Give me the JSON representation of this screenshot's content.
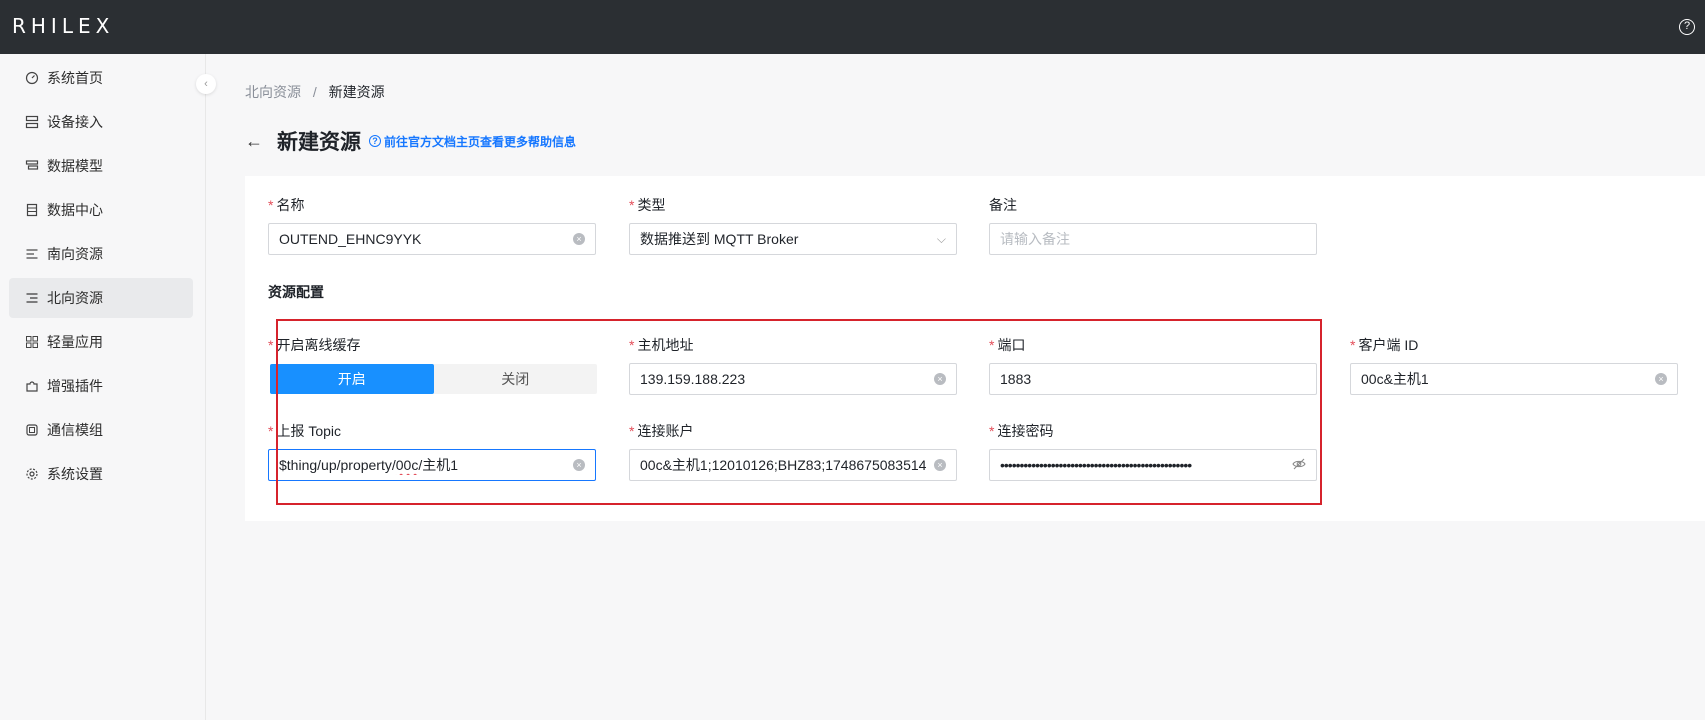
{
  "app": {
    "logo": "RHILEX",
    "help_icon": "help-circle-icon"
  },
  "sidebar": {
    "items": [
      {
        "label": "系统首页",
        "icon": "dashboard-icon",
        "active": false
      },
      {
        "label": "设备接入",
        "icon": "device-icon",
        "active": false
      },
      {
        "label": "数据模型",
        "icon": "model-icon",
        "active": false
      },
      {
        "label": "数据中心",
        "icon": "database-icon",
        "active": false
      },
      {
        "label": "南向资源",
        "icon": "south-resource-icon",
        "active": false
      },
      {
        "label": "北向资源",
        "icon": "north-resource-icon",
        "active": true
      },
      {
        "label": "轻量应用",
        "icon": "apps-icon",
        "active": false
      },
      {
        "label": "增强插件",
        "icon": "plugin-icon",
        "active": false
      },
      {
        "label": "通信模组",
        "icon": "module-icon",
        "active": false
      },
      {
        "label": "系统设置",
        "icon": "settings-icon",
        "active": false
      }
    ]
  },
  "breadcrumb": {
    "parent": "北向资源",
    "separator": "/",
    "current": "新建资源"
  },
  "header": {
    "title": "新建资源",
    "doc_link": "前往官方文档主页查看更多帮助信息"
  },
  "form": {
    "name": {
      "label": "名称",
      "required": true,
      "value": "OUTEND_EHNC9YYK"
    },
    "type": {
      "label": "类型",
      "required": true,
      "value": "数据推送到 MQTT Broker"
    },
    "remark": {
      "label": "备注",
      "required": false,
      "value": "",
      "placeholder": "请输入备注"
    },
    "section_title": "资源配置",
    "cache": {
      "label": "开启离线缓存",
      "required": true,
      "on_label": "开启",
      "off_label": "关闭",
      "selected": "开启"
    },
    "host": {
      "label": "主机地址",
      "required": true,
      "value": "139.159.188.223"
    },
    "port": {
      "label": "端口",
      "required": true,
      "value": "1883"
    },
    "client_id": {
      "label": "客户端 ID",
      "required": true,
      "value": "00c&主机1"
    },
    "topic": {
      "label": "上报 Topic",
      "required": true,
      "value_prefix": "$thing/up/property/",
      "value_misspelled": "00c",
      "value_suffix": "/主机1"
    },
    "username": {
      "label": "连接账户",
      "required": true,
      "value": "00c&主机1;12010126;BHZ83;1748675083514"
    },
    "password": {
      "label": "连接密码",
      "required": true,
      "value": "•••••••••••••••••••••••••••••••••••••••••••••••••"
    }
  },
  "colors": {
    "accent": "#1890ff",
    "required": "#e34d59",
    "highlight_box": "#d6232c",
    "topbar": "#2b2f33"
  }
}
